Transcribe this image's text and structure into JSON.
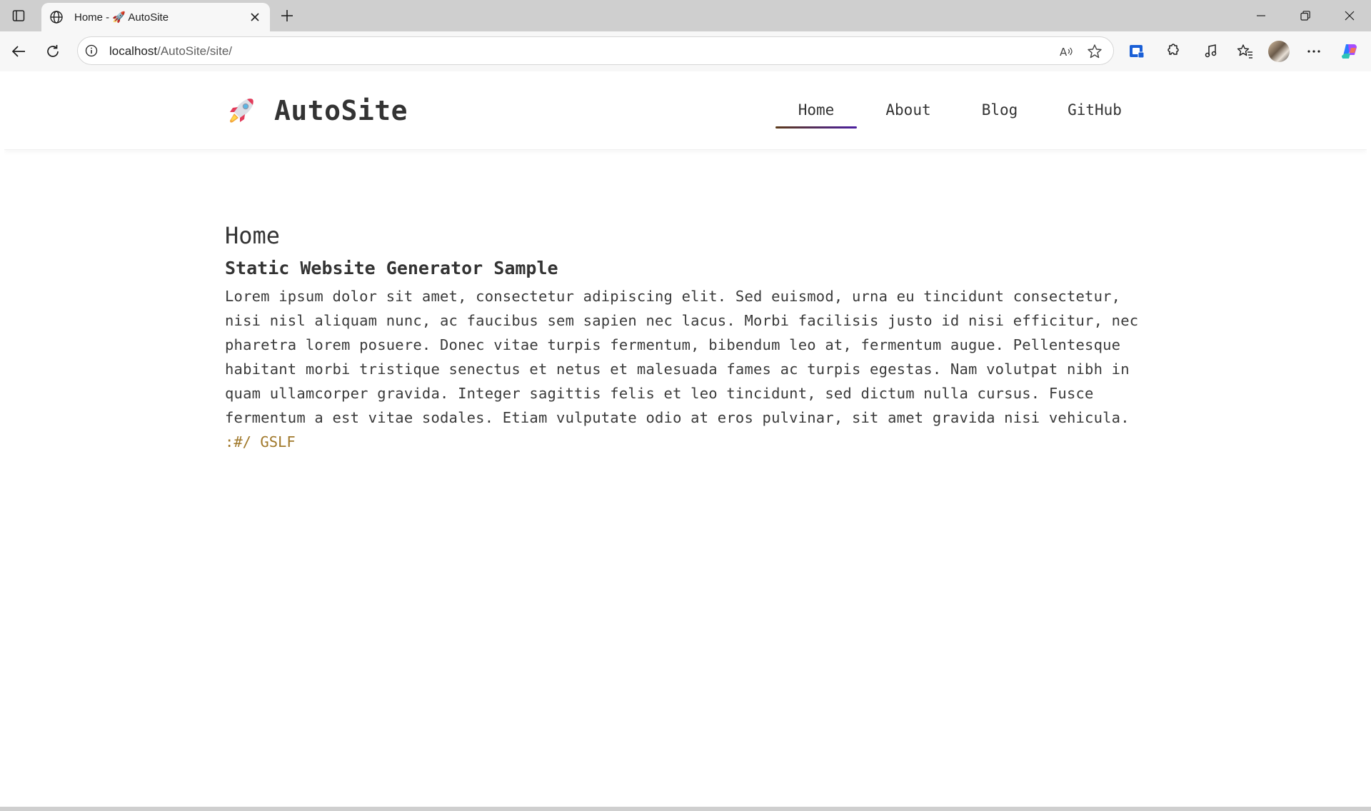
{
  "browser": {
    "tab": {
      "title": "Home - 🚀 AutoSite",
      "favicon": "globe-icon"
    },
    "address_bar": {
      "host": "localhost",
      "path": "/AutoSite/site/"
    },
    "icons": {
      "tab_actions": "tab-actions-icon",
      "new_tab": "plus-icon",
      "minimize": "minimize-icon",
      "restore": "restore-icon",
      "close": "close-icon",
      "back": "back-arrow-icon",
      "refresh": "refresh-icon",
      "site_info": "info-icon",
      "read_aloud": "read-aloud-icon",
      "favorite": "star-icon",
      "extension_1": "shield-extension-icon",
      "extensions": "puzzle-icon",
      "media": "music-note-icon",
      "favorites": "favorites-icon",
      "profile": "avatar",
      "more": "more-icon",
      "copilot": "copilot-icon"
    }
  },
  "site": {
    "brand": {
      "logo": "🚀",
      "name": "AutoSite"
    },
    "nav": [
      {
        "label": "Home",
        "active": true
      },
      {
        "label": "About",
        "active": false
      },
      {
        "label": "Blog",
        "active": false
      },
      {
        "label": "GitHub",
        "active": false
      }
    ],
    "content": {
      "heading": "Home",
      "subheading": "Static Website Generator Sample",
      "paragraph": "Lorem ipsum dolor sit amet, consectetur adipiscing elit. Sed euismod, urna eu tincidunt consectetur, nisi nisl aliquam nunc, ac faucibus sem sapien nec lacus. Morbi facilisis justo id nisi efficitur, nec pharetra lorem posuere. Donec vitae turpis fermentum, bibendum leo at, fermentum augue. Pellentesque habitant morbi tristique senectus et netus et malesuada fames ac turpis egestas. Nam volutpat nibh in quam ullamcorper gravida. Integer sagittis felis et leo tincidunt, sed dictum nulla cursus. Fusce fermentum a est vitae sodales. Etiam vulputate odio at eros pulvinar, sit amet gravida nisi vehicula.",
      "signature": ":#/ GSLF"
    }
  },
  "colors": {
    "text": "#333333",
    "signature": "#a0782a",
    "nav_underline_start": "#5c3a1a",
    "nav_underline_end": "#4b1fa0",
    "chrome": "#cfcfcf"
  }
}
